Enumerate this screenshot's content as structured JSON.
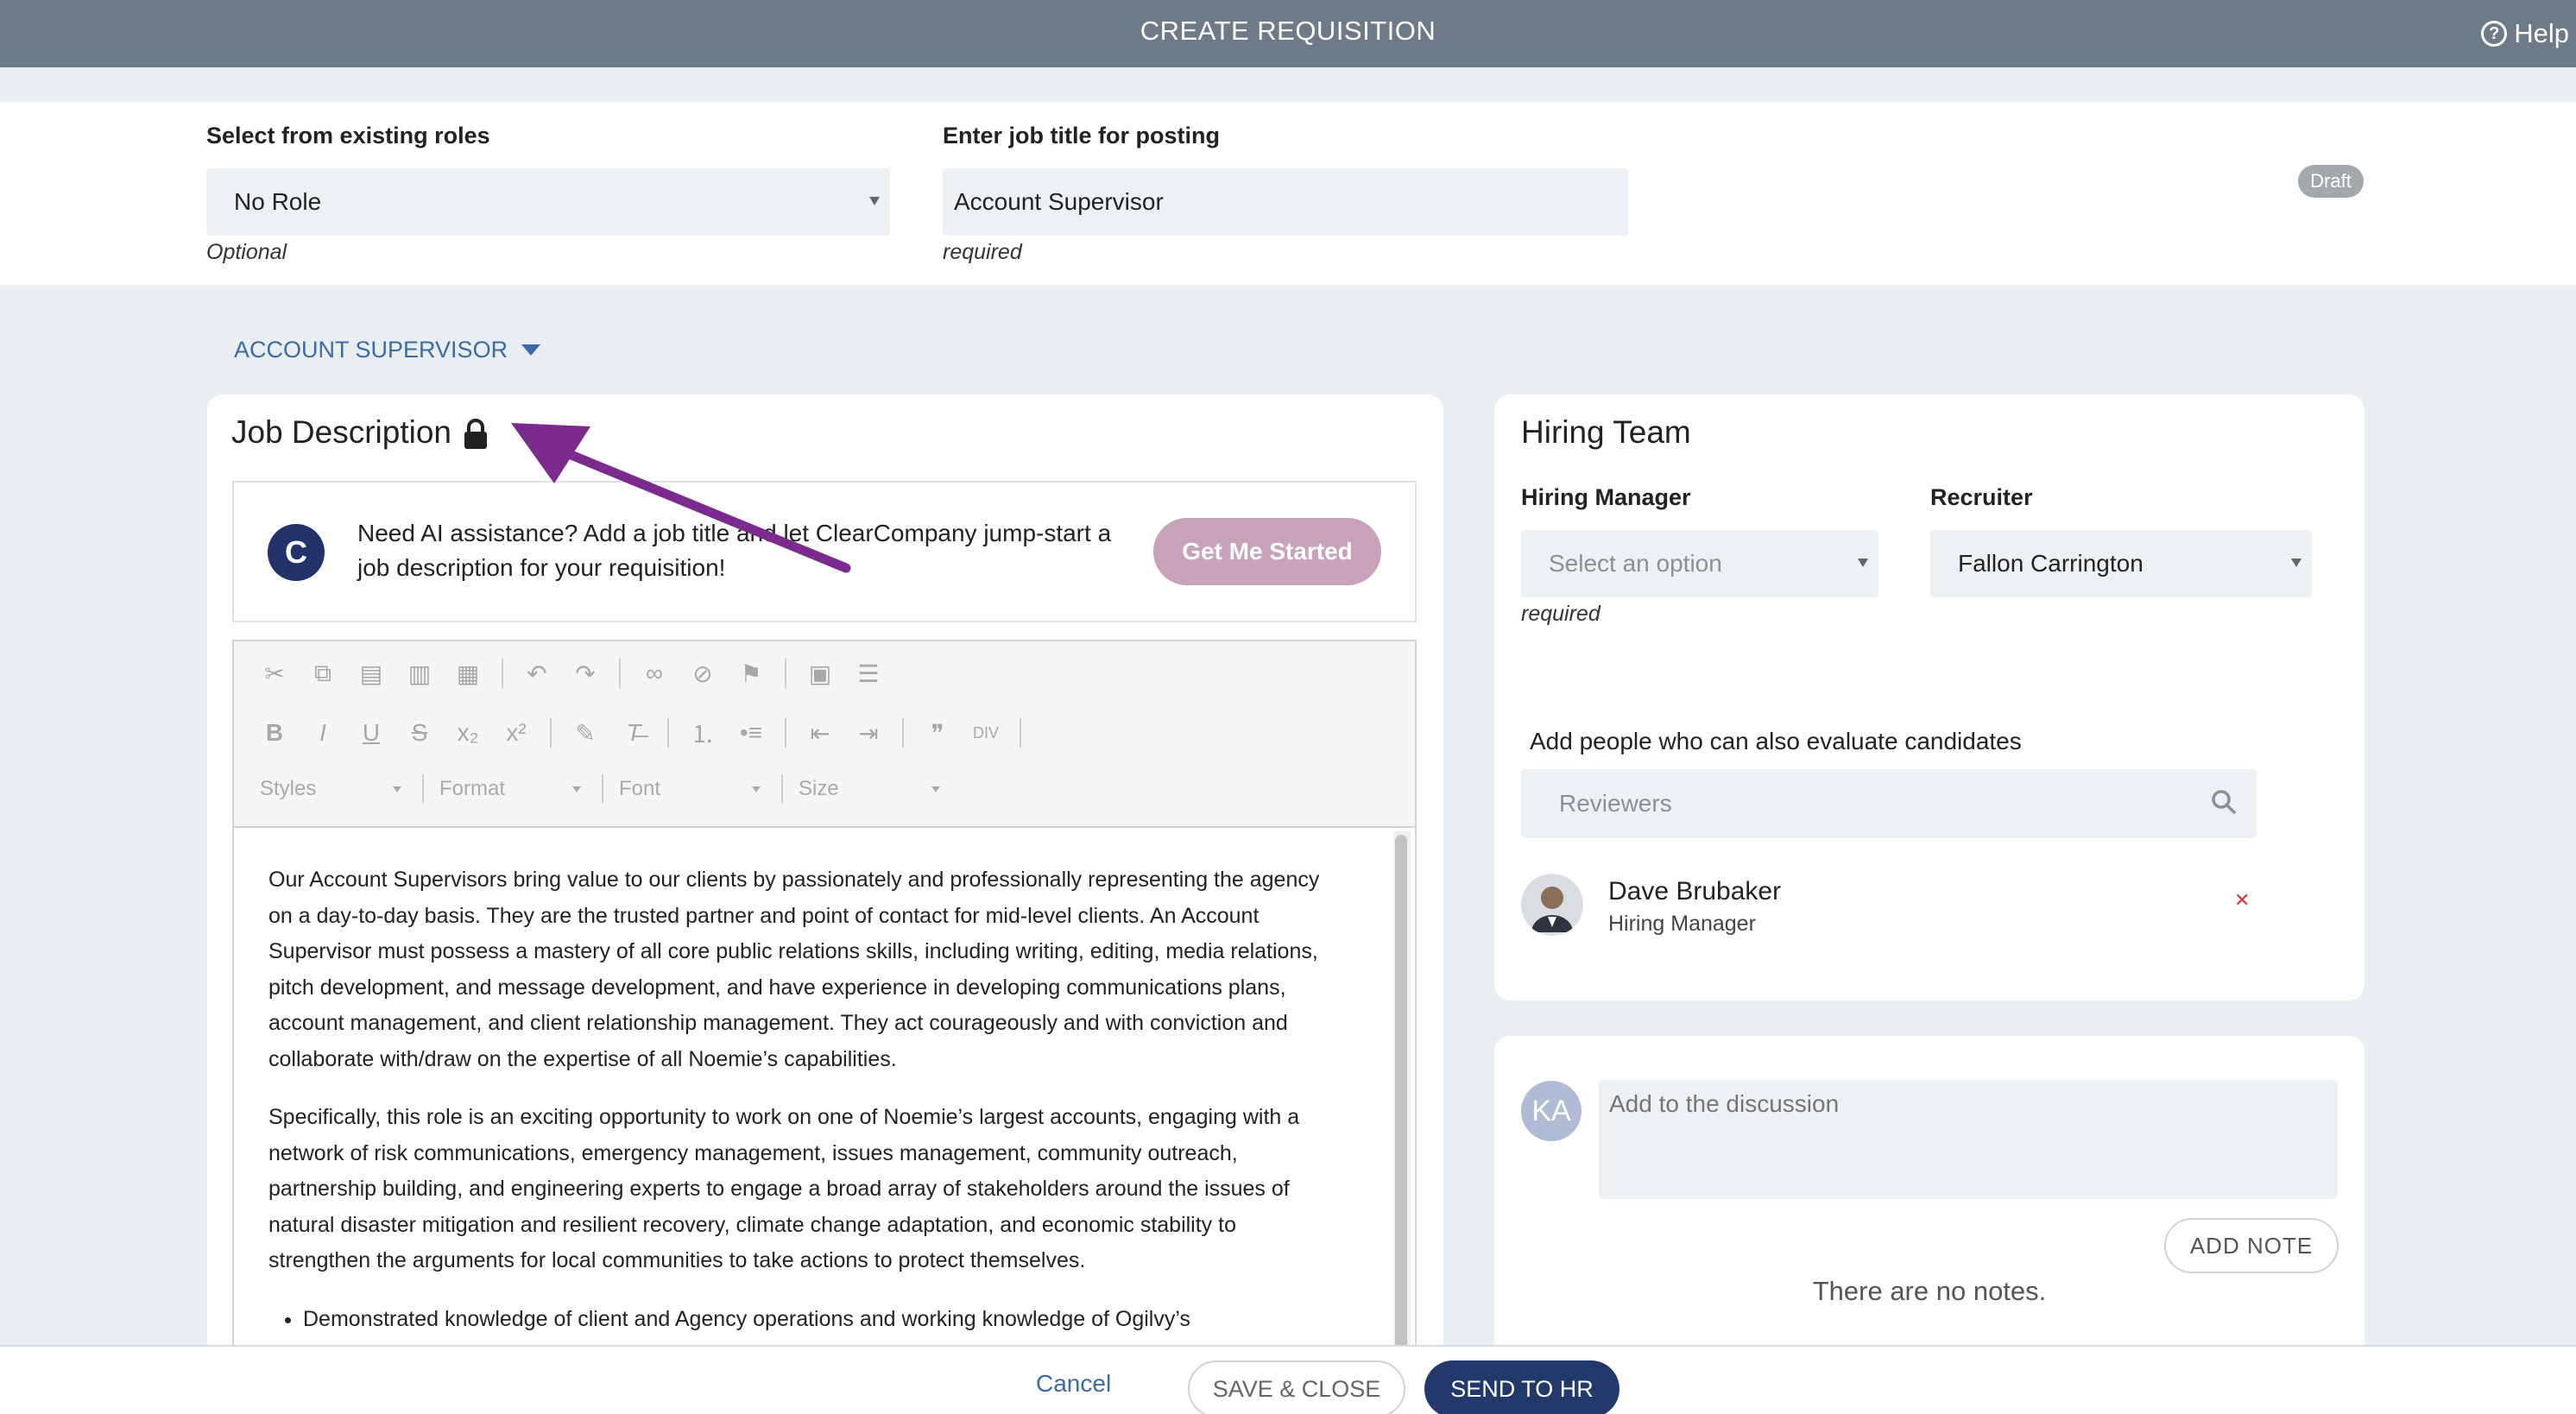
{
  "header": {
    "title": "CREATE REQUISITION",
    "help_label": "Help"
  },
  "role_section": {
    "existing_roles_label": "Select from existing roles",
    "existing_roles_value": "No Role",
    "existing_roles_hint": "Optional",
    "job_title_label": "Enter job title for posting",
    "job_title_value": "Account Supervisor",
    "job_title_hint": "required",
    "status_badge": "Draft"
  },
  "section_toggle": {
    "label": "ACCOUNT SUPERVISOR"
  },
  "job_description": {
    "title": "Job Description",
    "ai_prompt": "Need AI assistance? Add a job title and let ClearCompany jump-start a job description for your requisition!",
    "ai_button": "Get Me Started",
    "toolbar": {
      "styles": "Styles",
      "format": "Format",
      "font": "Font",
      "size": "Size"
    },
    "paragraphs": [
      "Our Account Supervisors bring value to our clients by passionately and professionally representing the agency on a day-to-day basis. They are the trusted partner and point of contact for mid-level clients. An Account Supervisor must possess a mastery of all core public relations skills, including writing, editing, media relations, pitch development, and message development, and have experience in developing communications plans, account management, and client relationship management. They act courageously and with conviction and collaborate with/draw on the expertise of all Noemie’s capabilities.",
      "Specifically, this role is an exciting opportunity to work on one of Noemie’s largest accounts, engaging with a network of risk communications, emergency management, issues management, community outreach, partnership building, and engineering experts to engage a broad array of stakeholders around the issues of natural disaster mitigation and resilient recovery, climate change adaptation, and economic stability to strengthen the arguments for local communities to take actions to protect themselves."
    ],
    "bullets": [
      "Demonstrated knowledge of client and Agency operations and working knowledge of Ogilvy’s"
    ]
  },
  "hiring_team": {
    "title": "Hiring Team",
    "manager_label": "Hiring Manager",
    "manager_placeholder": "Select an option",
    "manager_hint": "required",
    "recruiter_label": "Recruiter",
    "recruiter_value": "Fallon Carrington",
    "reviewers_label": "Add people who can also evaluate candidates",
    "reviewers_placeholder": "Reviewers",
    "members": [
      {
        "name": "Dave Brubaker",
        "role": "Hiring Manager"
      }
    ]
  },
  "notes": {
    "avatar_initials": "KA",
    "input_placeholder": "Add to the discussion",
    "add_button": "ADD NOTE",
    "empty_text": "There are no notes."
  },
  "footer": {
    "cancel": "Cancel",
    "save_close": "SAVE & CLOSE",
    "send_hr": "SEND TO HR"
  },
  "colors": {
    "header_bg": "#6c7b87",
    "accent": "#3d6aa8",
    "primary_button": "#23396b",
    "ai_button": "#c8a2ba",
    "annotation_arrow": "#7b2a8e"
  }
}
